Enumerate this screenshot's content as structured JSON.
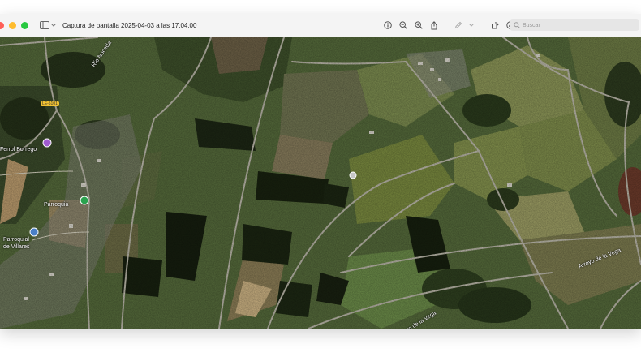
{
  "window": {
    "title": "Captura de pantalla 2025-04-03 a las 17.04.00",
    "search_placeholder": "Buscar"
  },
  "toolbar": {
    "icons": [
      "info-icon",
      "zoom-out-icon",
      "zoom-in-icon",
      "share-icon",
      "markup-icon",
      "chevron-down-icon",
      "rotate-icon",
      "annotate-icon"
    ]
  },
  "map": {
    "labels": {
      "river_north": "Río Noceda",
      "place_center": "Ferrol Borrego",
      "place_mid": "Parroquia",
      "place_parish_1": "Parroquial",
      "place_parish_2": "de Villares",
      "arroyo_east": "Arroyo de la Vega",
      "arroyo_south": "Arroyo de la Vega",
      "route": "LE-5101"
    }
  }
}
